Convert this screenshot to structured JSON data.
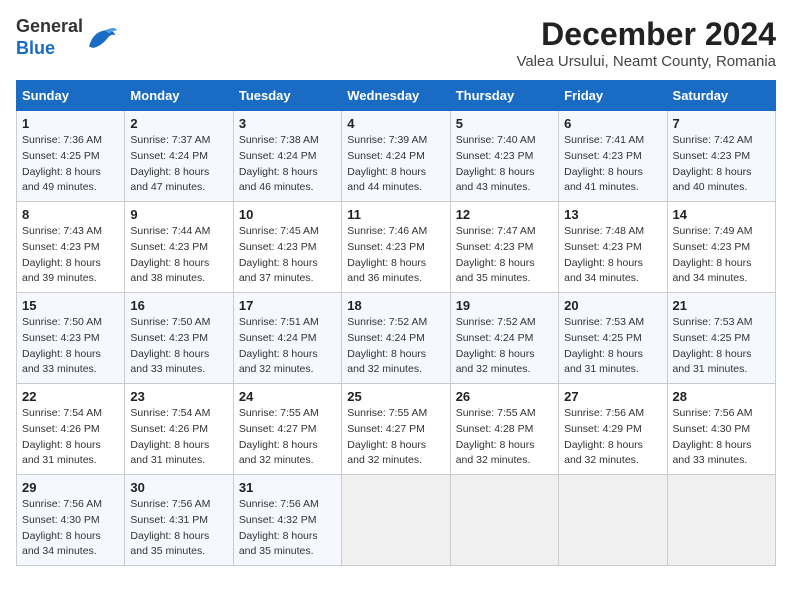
{
  "header": {
    "logo_line1": "General",
    "logo_line2": "Blue",
    "month_title": "December 2024",
    "location": "Valea Ursului, Neamt County, Romania"
  },
  "calendar": {
    "weekdays": [
      "Sunday",
      "Monday",
      "Tuesday",
      "Wednesday",
      "Thursday",
      "Friday",
      "Saturday"
    ],
    "weeks": [
      [
        {
          "day": "1",
          "sunrise": "7:36 AM",
          "sunset": "4:25 PM",
          "daylight": "8 hours and 49 minutes."
        },
        {
          "day": "2",
          "sunrise": "7:37 AM",
          "sunset": "4:24 PM",
          "daylight": "8 hours and 47 minutes."
        },
        {
          "day": "3",
          "sunrise": "7:38 AM",
          "sunset": "4:24 PM",
          "daylight": "8 hours and 46 minutes."
        },
        {
          "day": "4",
          "sunrise": "7:39 AM",
          "sunset": "4:24 PM",
          "daylight": "8 hours and 44 minutes."
        },
        {
          "day": "5",
          "sunrise": "7:40 AM",
          "sunset": "4:23 PM",
          "daylight": "8 hours and 43 minutes."
        },
        {
          "day": "6",
          "sunrise": "7:41 AM",
          "sunset": "4:23 PM",
          "daylight": "8 hours and 41 minutes."
        },
        {
          "day": "7",
          "sunrise": "7:42 AM",
          "sunset": "4:23 PM",
          "daylight": "8 hours and 40 minutes."
        }
      ],
      [
        {
          "day": "8",
          "sunrise": "7:43 AM",
          "sunset": "4:23 PM",
          "daylight": "8 hours and 39 minutes."
        },
        {
          "day": "9",
          "sunrise": "7:44 AM",
          "sunset": "4:23 PM",
          "daylight": "8 hours and 38 minutes."
        },
        {
          "day": "10",
          "sunrise": "7:45 AM",
          "sunset": "4:23 PM",
          "daylight": "8 hours and 37 minutes."
        },
        {
          "day": "11",
          "sunrise": "7:46 AM",
          "sunset": "4:23 PM",
          "daylight": "8 hours and 36 minutes."
        },
        {
          "day": "12",
          "sunrise": "7:47 AM",
          "sunset": "4:23 PM",
          "daylight": "8 hours and 35 minutes."
        },
        {
          "day": "13",
          "sunrise": "7:48 AM",
          "sunset": "4:23 PM",
          "daylight": "8 hours and 34 minutes."
        },
        {
          "day": "14",
          "sunrise": "7:49 AM",
          "sunset": "4:23 PM",
          "daylight": "8 hours and 34 minutes."
        }
      ],
      [
        {
          "day": "15",
          "sunrise": "7:50 AM",
          "sunset": "4:23 PM",
          "daylight": "8 hours and 33 minutes."
        },
        {
          "day": "16",
          "sunrise": "7:50 AM",
          "sunset": "4:23 PM",
          "daylight": "8 hours and 33 minutes."
        },
        {
          "day": "17",
          "sunrise": "7:51 AM",
          "sunset": "4:24 PM",
          "daylight": "8 hours and 32 minutes."
        },
        {
          "day": "18",
          "sunrise": "7:52 AM",
          "sunset": "4:24 PM",
          "daylight": "8 hours and 32 minutes."
        },
        {
          "day": "19",
          "sunrise": "7:52 AM",
          "sunset": "4:24 PM",
          "daylight": "8 hours and 32 minutes."
        },
        {
          "day": "20",
          "sunrise": "7:53 AM",
          "sunset": "4:25 PM",
          "daylight": "8 hours and 31 minutes."
        },
        {
          "day": "21",
          "sunrise": "7:53 AM",
          "sunset": "4:25 PM",
          "daylight": "8 hours and 31 minutes."
        }
      ],
      [
        {
          "day": "22",
          "sunrise": "7:54 AM",
          "sunset": "4:26 PM",
          "daylight": "8 hours and 31 minutes."
        },
        {
          "day": "23",
          "sunrise": "7:54 AM",
          "sunset": "4:26 PM",
          "daylight": "8 hours and 31 minutes."
        },
        {
          "day": "24",
          "sunrise": "7:55 AM",
          "sunset": "4:27 PM",
          "daylight": "8 hours and 32 minutes."
        },
        {
          "day": "25",
          "sunrise": "7:55 AM",
          "sunset": "4:27 PM",
          "daylight": "8 hours and 32 minutes."
        },
        {
          "day": "26",
          "sunrise": "7:55 AM",
          "sunset": "4:28 PM",
          "daylight": "8 hours and 32 minutes."
        },
        {
          "day": "27",
          "sunrise": "7:56 AM",
          "sunset": "4:29 PM",
          "daylight": "8 hours and 32 minutes."
        },
        {
          "day": "28",
          "sunrise": "7:56 AM",
          "sunset": "4:30 PM",
          "daylight": "8 hours and 33 minutes."
        }
      ],
      [
        {
          "day": "29",
          "sunrise": "7:56 AM",
          "sunset": "4:30 PM",
          "daylight": "8 hours and 34 minutes."
        },
        {
          "day": "30",
          "sunrise": "7:56 AM",
          "sunset": "4:31 PM",
          "daylight": "8 hours and 35 minutes."
        },
        {
          "day": "31",
          "sunrise": "7:56 AM",
          "sunset": "4:32 PM",
          "daylight": "8 hours and 35 minutes."
        },
        null,
        null,
        null,
        null
      ]
    ]
  }
}
